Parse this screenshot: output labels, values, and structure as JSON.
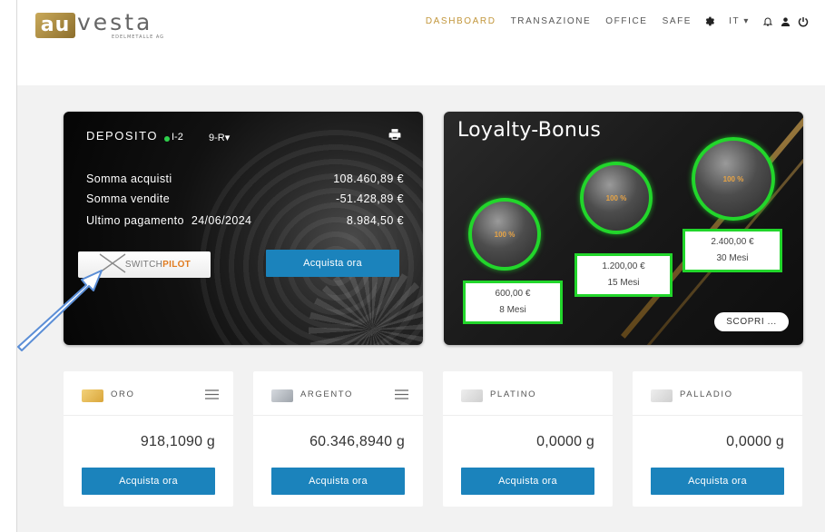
{
  "brand": {
    "logo_mark": "au",
    "logo_word": "vesta",
    "logo_sub": "EDELMETALLE AG"
  },
  "nav": {
    "items": [
      "DASHBOARD",
      "TRANSAZIONE",
      "OFFICE",
      "SAFE"
    ],
    "language": "IT",
    "icons": [
      "gear-icon",
      "bell-icon",
      "user-icon",
      "power-icon"
    ],
    "active_color": "#c2963b"
  },
  "deposit": {
    "title": "DEPOSITO",
    "code": "I-2",
    "selector": "9-R",
    "rows": [
      {
        "label": "Somma acquisti",
        "date": "",
        "value": "108.460,89 €"
      },
      {
        "label": "Somma vendite",
        "date": "",
        "value": "-51.428,89 €"
      },
      {
        "label": "Ultimo pagamento",
        "date": "24/06/2024",
        "value": "8.984,50 €"
      }
    ],
    "switchpilot_light": "SWITCH",
    "switchpilot_bold": "PILOT",
    "buy_label": "Acquista ora"
  },
  "loyalty": {
    "title": "Loyalty-Bonus",
    "tiers": [
      {
        "percent": "100 %",
        "amount": "600,00 €",
        "period": "8 Mesi"
      },
      {
        "percent": "100 %",
        "amount": "1.200,00 €",
        "period": "15 Mesi"
      },
      {
        "percent": "100 %",
        "amount": "2.400,00 €",
        "period": "30 Mesi"
      }
    ],
    "discover_label": "SCOPRI ...",
    "ring_color": "#22d62b"
  },
  "metals": [
    {
      "name": "ORO",
      "value": "918,1090 g",
      "buy_label": "Acquista ora",
      "color": "#e6b94a"
    },
    {
      "name": "ARGENTO",
      "value": "60.346,8940 g",
      "buy_label": "Acquista ora",
      "color": "#b7bcc3"
    },
    {
      "name": "PLATINO",
      "value": "0,0000 g",
      "buy_label": "Acquista ora",
      "color": "#d8d8d8"
    },
    {
      "name": "PALLADIO",
      "value": "0,0000 g",
      "buy_label": "Acquista ora",
      "color": "#d8d8d8"
    }
  ],
  "accent_blue": "#1b83bc"
}
